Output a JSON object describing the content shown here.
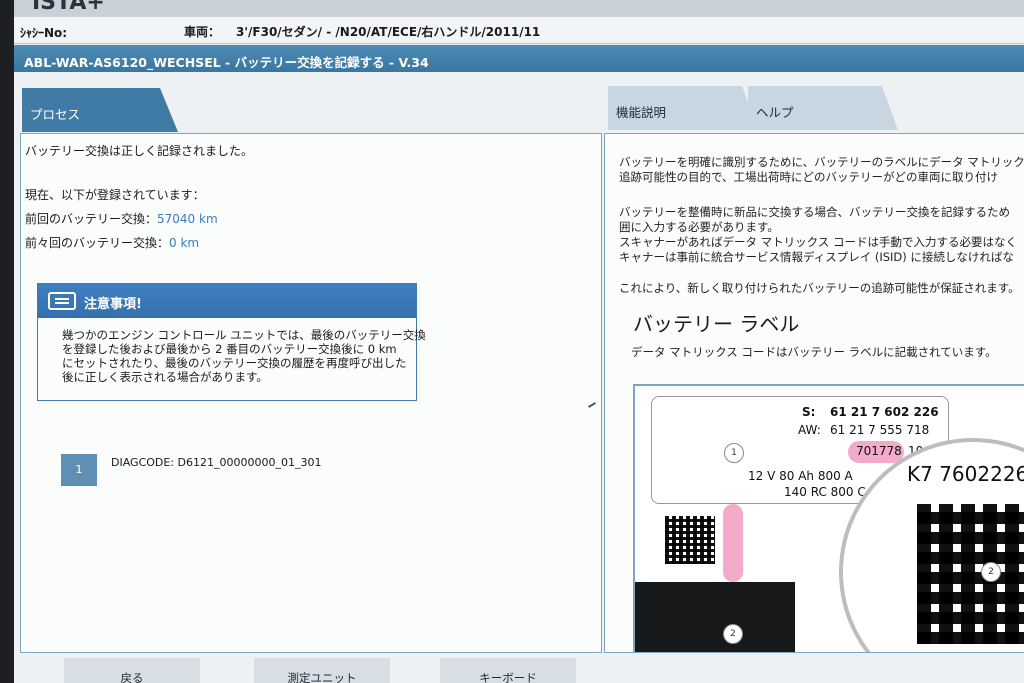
{
  "app": {
    "title": "ISTA+"
  },
  "vehicle": {
    "chassis_label": "ｼｬｼｰNo:",
    "vehicle_label": "車両：",
    "vehicle_value": "3'/F30/セダン/ - /N20/AT/ECE/右ハンドル/2011/11"
  },
  "page": {
    "title": "ABL-WAR-AS6120_WECHSEL - バッテリー交換を記録する - V.34"
  },
  "tabs": {
    "process": "プロセス",
    "function": "機能説明",
    "help": "ヘルプ"
  },
  "left": {
    "status": "バッテリー交換は正しく記録されました。",
    "registered_heading": "現在、以下が登録されています：",
    "last_label": "前回のバッテリー交換：",
    "last_value": "57040 km",
    "prev_label": "前々回のバッテリー交換：",
    "prev_value": "0 km",
    "notice": {
      "title": "注意事項!",
      "lines": [
        "幾つかのエンジン コントロール ユニットでは、最後のバッテリー交換",
        "を登録した後および最後から 2 番目のバッテリー交換後に 0 km",
        "にセットされたり、最後のバッテリー交換の履歴を再度呼び出した",
        "後に正しく表示される場合があります。"
      ]
    },
    "step_number": "1",
    "diag_code": "DIAGCODE: D6121_00000000_01_301"
  },
  "right": {
    "p1_line1": "バッテリーを明確に識別するために、バッテリーのラベルにデータ マトリック",
    "p1_line2": "追跡可能性の目的で、工場出荷時にどのバッテリーがどの車両に取り付け",
    "p2_line1": "バッテリーを整備時に新品に交換する場合、バッテリー交換を記録するため",
    "p2_line2": "囲に入力する必要があります。",
    "p2_line3": "スキャナーがあればデータ マトリックス コードは手動で入力する必要はなく",
    "p2_line4": "キャナーは事前に統合サービス情報ディスプレイ (ISID) に接続しなければな",
    "p3": "これにより、新しく取り付けられたバッテリーの追跡可能性が保証されます。",
    "heading": "バッテリー ラベル",
    "sub": "データ マトリックス コードはバッテリー ラベルに記載されています。",
    "label": {
      "s_label": "S:",
      "s_value": "61 21 7 602 226",
      "aw_label": "AW:",
      "aw_value": "61 21 7 555 718",
      "highlight_value": "701778",
      "tail_value": "10 AT",
      "spec_line1": "12 V  80 Ah   800 A",
      "spec_line2": "140 RC 800 C",
      "zoom_text": "K7 7602226",
      "callout_1": "1",
      "callout_2": "2",
      "callout_2b": "2"
    }
  },
  "buttons": {
    "back": "戻る",
    "measure": "測定ユニット",
    "keyboard": "キーボード"
  }
}
